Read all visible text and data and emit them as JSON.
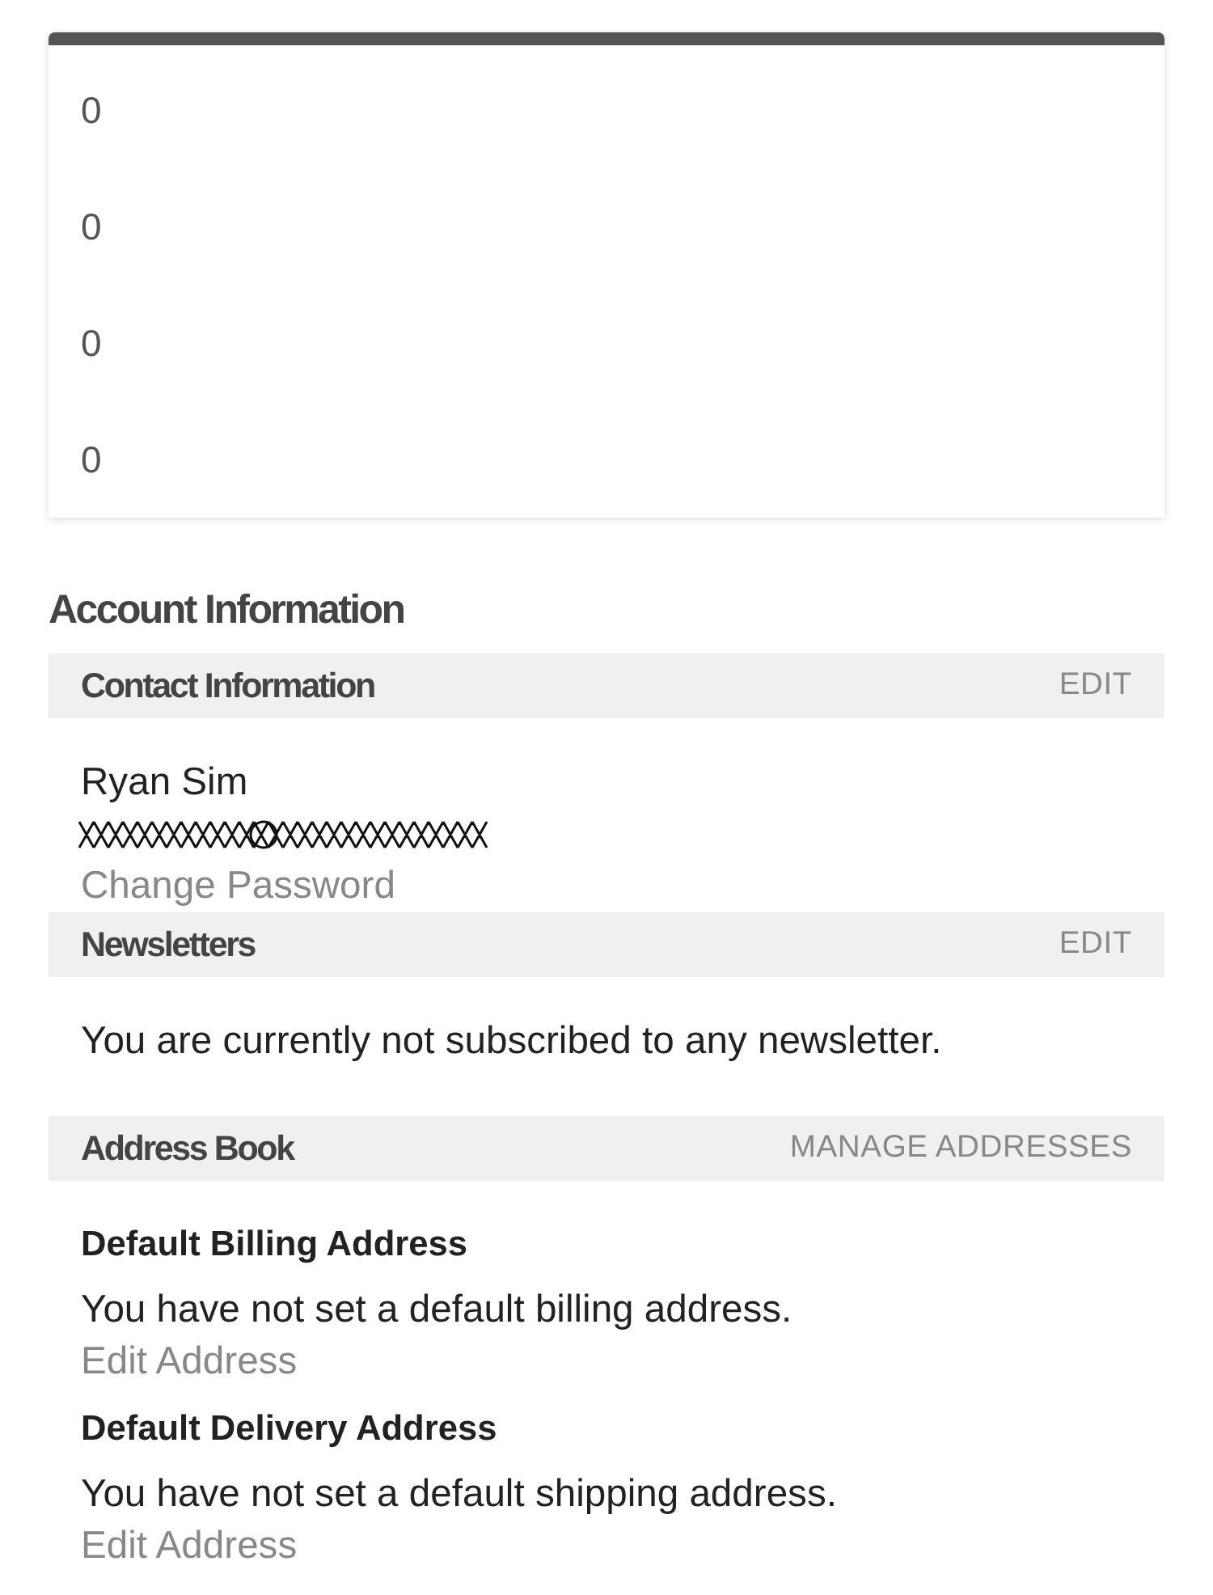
{
  "summary_card": {
    "values": [
      "0",
      "0",
      "0",
      "0"
    ]
  },
  "account": {
    "title": "Account Information",
    "sections": [
      {
        "kind": "contact",
        "title": "Contact Information",
        "action": "EDIT",
        "name": "Ryan Sim",
        "email": {
          "redacted": true
        },
        "link": "Change Password"
      },
      {
        "kind": "newsletters",
        "title": "Newsletters",
        "action": "EDIT",
        "message": "You are currently not subscribed to any newsletter."
      },
      {
        "kind": "address_book",
        "title": "Address Book",
        "action": "MANAGE ADDRESSES",
        "addresses": [
          {
            "title": "Default Billing Address",
            "message": "You have not set a default billing address.",
            "link": "Edit Address"
          },
          {
            "title": "Default Delivery Address",
            "message": "You have not set a default shipping address.",
            "link": "Edit Address"
          }
        ]
      }
    ]
  }
}
